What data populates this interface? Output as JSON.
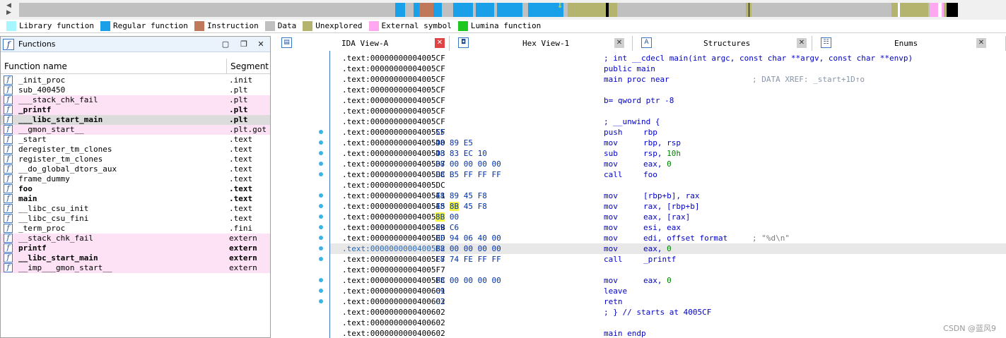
{
  "legend": [
    {
      "label": "Library function",
      "color": "#a6f6ff"
    },
    {
      "label": "Regular function",
      "color": "#1aa0e8"
    },
    {
      "label": "Instruction",
      "color": "#c0785a"
    },
    {
      "label": "Data",
      "color": "#c0c0c0"
    },
    {
      "label": "Unexplored",
      "color": "#b4b46e"
    },
    {
      "label": "External symbol",
      "color": "#ffa8f0"
    },
    {
      "label": "Lumina function",
      "color": "#1ec81e"
    }
  ],
  "navbar_segments": [
    {
      "type": "data",
      "color": "#c0c0c0"
    },
    {
      "type": "regular",
      "color": "#1aa0e8"
    },
    {
      "type": "data",
      "color": "#c0c0c0"
    },
    {
      "type": "regular",
      "color": "#1aa0e8"
    },
    {
      "type": "instruction",
      "color": "#c0785a"
    },
    {
      "type": "regular",
      "color": "#1aa0e8"
    },
    {
      "type": "data",
      "color": "#c0c0c0"
    },
    {
      "type": "regular",
      "color": "#1aa0e8"
    },
    {
      "type": "data",
      "color": "#c0c0c0"
    },
    {
      "type": "regular",
      "color": "#1aa0e8"
    },
    {
      "type": "data",
      "color": "#c0c0c0"
    },
    {
      "type": "regular",
      "color": "#1aa0e8"
    },
    {
      "type": "data",
      "color": "#c0c0c0"
    },
    {
      "type": "regular",
      "color": "#1aa0e8"
    },
    {
      "type": "data",
      "color": "#c0c0c0"
    },
    {
      "type": "unexplored",
      "color": "#b4b46e"
    },
    {
      "type": "black",
      "color": "#000000"
    },
    {
      "type": "unexplored",
      "color": "#b4b46e"
    },
    {
      "type": "data",
      "color": "#c0c0c0"
    },
    {
      "type": "unexplored",
      "color": "#b4b46e"
    },
    {
      "type": "data",
      "color": "#c0c0c0"
    },
    {
      "type": "unexplored",
      "color": "#b4b46e"
    },
    {
      "type": "external",
      "color": "#ffa8f0"
    },
    {
      "type": "black",
      "color": "#000000"
    }
  ],
  "functions_panel": {
    "title": "Functions",
    "col_name": "Function name",
    "col_segment": "Segment",
    "rows": [
      {
        "name": "_init_proc",
        "segment": ".init",
        "pink": false,
        "bold": false,
        "selected": false
      },
      {
        "name": "sub_400450",
        "segment": ".plt",
        "pink": false,
        "bold": false,
        "selected": false
      },
      {
        "name": "___stack_chk_fail",
        "segment": ".plt",
        "pink": true,
        "bold": false,
        "selected": false
      },
      {
        "name": "_printf",
        "segment": ".plt",
        "pink": true,
        "bold": true,
        "selected": false
      },
      {
        "name": "___libc_start_main",
        "segment": ".plt",
        "pink": false,
        "bold": true,
        "selected": true
      },
      {
        "name": "__gmon_start__",
        "segment": ".plt.got",
        "pink": true,
        "bold": false,
        "selected": false
      },
      {
        "name": "_start",
        "segment": ".text",
        "pink": false,
        "bold": false,
        "selected": false
      },
      {
        "name": "deregister_tm_clones",
        "segment": ".text",
        "pink": false,
        "bold": false,
        "selected": false
      },
      {
        "name": "register_tm_clones",
        "segment": ".text",
        "pink": false,
        "bold": false,
        "selected": false
      },
      {
        "name": "__do_global_dtors_aux",
        "segment": ".text",
        "pink": false,
        "bold": false,
        "selected": false
      },
      {
        "name": "frame_dummy",
        "segment": ".text",
        "pink": false,
        "bold": false,
        "selected": false
      },
      {
        "name": "foo",
        "segment": ".text",
        "pink": false,
        "bold": true,
        "selected": false
      },
      {
        "name": "main",
        "segment": ".text",
        "pink": false,
        "bold": true,
        "selected": false
      },
      {
        "name": "__libc_csu_init",
        "segment": ".text",
        "pink": false,
        "bold": false,
        "selected": false
      },
      {
        "name": "__libc_csu_fini",
        "segment": ".text",
        "pink": false,
        "bold": false,
        "selected": false
      },
      {
        "name": "_term_proc",
        "segment": ".fini",
        "pink": false,
        "bold": false,
        "selected": false
      },
      {
        "name": "__stack_chk_fail",
        "segment": "extern",
        "pink": true,
        "bold": false,
        "selected": false
      },
      {
        "name": "printf",
        "segment": "extern",
        "pink": true,
        "bold": true,
        "selected": false
      },
      {
        "name": "__libc_start_main",
        "segment": "extern",
        "pink": true,
        "bold": true,
        "selected": false
      },
      {
        "name": "__imp___gmon_start__",
        "segment": "extern",
        "pink": true,
        "bold": false,
        "selected": false
      }
    ]
  },
  "tabs": [
    {
      "label": "IDA View-A",
      "icon": "document-icon",
      "active": true
    },
    {
      "label": "Hex View-1",
      "icon": "hex-icon",
      "active": false
    },
    {
      "label": "Structures",
      "icon": "structures-icon",
      "active": false
    },
    {
      "label": "Enums",
      "icon": "enums-icon",
      "active": false
    }
  ],
  "disasm_lines": [
    {
      "addr": ".text:00000000004005CF",
      "bytes": "",
      "cmt": "; int __cdecl main(int argc, const char **argv, const char **envp)"
    },
    {
      "addr": ".text:00000000004005CF",
      "bytes": "",
      "cmt": "public main"
    },
    {
      "addr": ".text:00000000004005CF",
      "bytes": "",
      "cmt": "main proc near",
      "xref": "; DATA XREF: _start+1D↑o"
    },
    {
      "addr": ".text:00000000004005CF",
      "bytes": ""
    },
    {
      "addr": ".text:00000000004005CF",
      "bytes": "",
      "cmt": "b= qword ptr -8"
    },
    {
      "addr": ".text:00000000004005CF",
      "bytes": ""
    },
    {
      "addr": ".text:00000000004005CF",
      "bytes": "",
      "cmt": "; __unwind {"
    },
    {
      "addr": ".text:00000000004005CF",
      "bytes": "55",
      "mn": "push",
      "op": "rbp",
      "dot": true,
      "collapse": true
    },
    {
      "addr": ".text:00000000004005D0",
      "bytes": "48 89 E5",
      "mn": "mov",
      "op": "rbp, rsp",
      "dot": true
    },
    {
      "addr": ".text:00000000004005D3",
      "bytes": "48 83 EC 10",
      "mn": "sub",
      "op": "rsp, ",
      "num": "10h",
      "dot": true
    },
    {
      "addr": ".text:00000000004005D7",
      "bytes": "B8 00 00 00 00",
      "mn": "mov",
      "op": "eax, ",
      "num": "0",
      "dot": true
    },
    {
      "addr": ".text:00000000004005DC",
      "bytes": "E8 B5 FF FF FF",
      "mn": "call",
      "op": "foo",
      "dot": true
    },
    {
      "addr": ".text:00000000004005DC",
      "bytes": ""
    },
    {
      "addr": ".text:00000000004005E1",
      "bytes": "48 89 45 F8",
      "mn": "mov",
      "op": "[rbp+b], rax",
      "dot": true
    },
    {
      "addr": ".text:00000000004005E5",
      "bytes_pre": "48 ",
      "bytes_hl": "8B",
      "bytes_post": " 45 F8",
      "mn": "mov",
      "op": "rax, [rbp+b]",
      "dot": true
    },
    {
      "addr": ".text:00000000004005E9",
      "bytes_pre": "",
      "bytes_hl": "8B",
      "bytes_post": " 00",
      "mn": "mov",
      "op": "eax, [rax]",
      "dot": true
    },
    {
      "addr": ".text:00000000004005EB",
      "bytes": "89 C6",
      "mn": "mov",
      "op": "esi, eax",
      "dot": true
    },
    {
      "addr": ".text:00000000004005ED",
      "bytes": "BF 94 06 40 00",
      "mn": "mov",
      "op": "edi, offset format",
      "str": "; \"%d\\n\"",
      "dot": true
    },
    {
      "addr": ".text:00000000004005F2",
      "bytes": "B8 00 00 00 00",
      "mn": "mov",
      "op": "eax, ",
      "num": "0",
      "dot": true,
      "highlight": true
    },
    {
      "addr": ".text:00000000004005F7",
      "bytes": "E8 74 FE FF FF",
      "mn": "call",
      "op": "_printf",
      "dot": true
    },
    {
      "addr": ".text:00000000004005F7",
      "bytes": ""
    },
    {
      "addr": ".text:00000000004005FC",
      "bytes": "B8 00 00 00 00",
      "mn": "mov",
      "op": "eax, ",
      "num": "0",
      "dot": true
    },
    {
      "addr": ".text:0000000000400601",
      "bytes": "C9",
      "mn": "leave",
      "op": "",
      "dot": true
    },
    {
      "addr": ".text:0000000000400602",
      "bytes": "C3",
      "mn": "retn",
      "op": "",
      "dot": true
    },
    {
      "addr": ".text:0000000000400602",
      "bytes": "",
      "cmt": "; } // starts at 4005CF"
    },
    {
      "addr": ".text:0000000000400602",
      "bytes": ""
    },
    {
      "addr": ".text:0000000000400602",
      "bytes": "",
      "cmt": "main endp"
    }
  ],
  "watermark": "CSDN @蓝风9"
}
